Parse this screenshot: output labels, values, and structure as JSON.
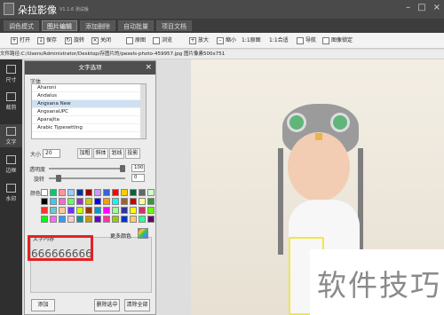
{
  "app": {
    "title": "朵拉影像",
    "version": "V1.1.6 测试版"
  },
  "tabs": [
    {
      "label": "调色模式"
    },
    {
      "label": "图片编辑"
    },
    {
      "label": "添加删除"
    },
    {
      "label": "自动批量"
    },
    {
      "label": "项目文档"
    }
  ],
  "toolbar": {
    "open": "打开",
    "save": "保存",
    "rotate": "旋转",
    "close": "关闭",
    "original": "原图",
    "browse": "浏览",
    "zoom_in": "放大",
    "zoom_out": "缩小",
    "actual": "1:1原图",
    "fit": "1:1合适",
    "navigate": "导航",
    "lock": "图像锁定"
  },
  "pathbar": {
    "text": "文件路径:C:/Users/Administrator/Desktop/存图片的/pexels-photo-459957.jpg    图片像素500x751"
  },
  "left_tools": [
    {
      "label": "尺寸"
    },
    {
      "label": "裁剪"
    },
    {
      "label": "文字"
    },
    {
      "label": "边框"
    },
    {
      "label": "水印"
    }
  ],
  "panel": {
    "title": "文字选项",
    "font_label": "字体",
    "fonts": [
      "Aharoni",
      "Andalus",
      "Angsana New",
      "AngsanaUPC",
      "Aparajita",
      "Arabic Typesetting"
    ],
    "selected_font_index": 2,
    "size_label": "大小",
    "size_value": "20",
    "styles": [
      "加粗",
      "斜体",
      "划线",
      "投影"
    ],
    "opacity_label": "透明度",
    "opacity_value": "100",
    "rotate_label": "旋转",
    "rotate_value": "0",
    "color_label": "颜色",
    "content_label": "文字内容",
    "more_colors": "更多颜色",
    "text_content": "666666666",
    "buttons": {
      "add": "添加",
      "delete_selected": "删除选中",
      "clear_all": "清除全部"
    },
    "swatch_colors": [
      "#ffffff",
      "#00cc66",
      "#ff9999",
      "#99ccff",
      "#003399",
      "#990000",
      "#cc99ff",
      "#3366cc",
      "#ff0000",
      "#ffcc00",
      "#006633",
      "#666666",
      "#ccffcc",
      "#ff6600",
      "#000000",
      "#33ccff",
      "#ff66cc",
      "#66ff66",
      "#9933cc",
      "#cccc00",
      "#0000ff",
      "#ff9900",
      "#00ffff",
      "#996633",
      "#cc0000",
      "#ffff99",
      "#339933",
      "#cc6699",
      "#ff3333",
      "#66cccc",
      "#ffcc99",
      "#6633ff",
      "#ccff00",
      "#993300",
      "#0099cc",
      "#ff00ff",
      "#99ff99",
      "#333399",
      "#ffff00",
      "#cc3366",
      "#66ff00",
      "#999999",
      "#00ff00",
      "#ff66ff",
      "#3399ff",
      "#ffcccc",
      "#009999",
      "#cc9900",
      "#6600cc",
      "#ff3399",
      "#99cc00",
      "#0033cc",
      "#ffcc66",
      "#33ff99",
      "#660066",
      "#cccccc"
    ]
  },
  "watermark": {
    "text": "软件技巧"
  }
}
